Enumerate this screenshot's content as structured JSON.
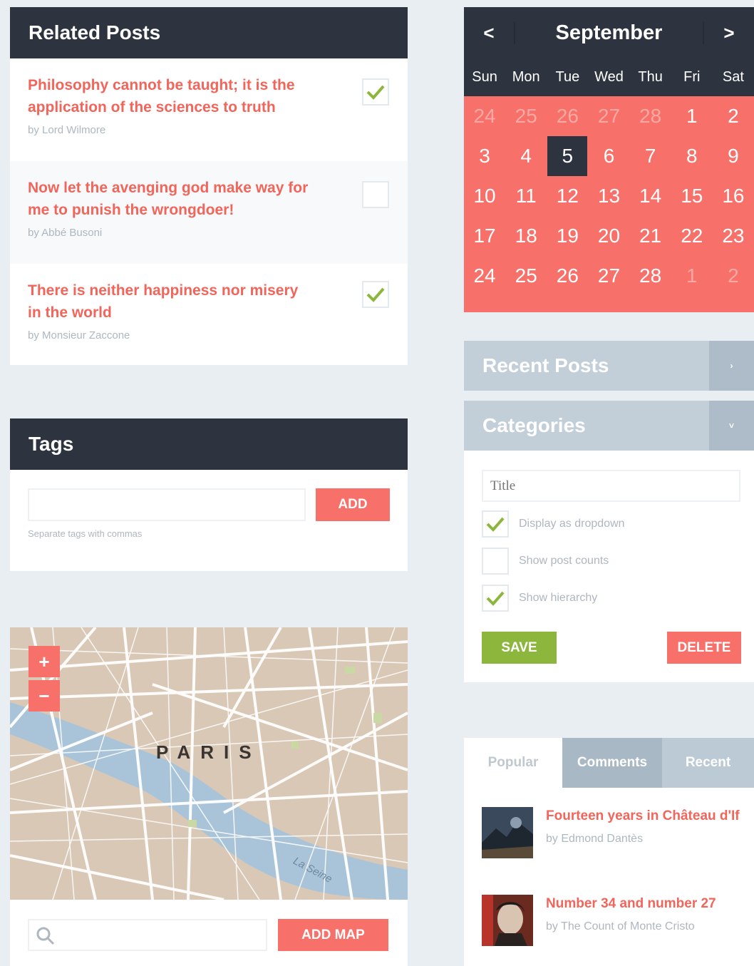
{
  "related_posts": {
    "title": "Related Posts",
    "items": [
      {
        "title": "Philosophy cannot be taught; it is the application of the sciences to truth",
        "author": "by Lord Wilmore",
        "checked": true
      },
      {
        "title": "Now let the avenging god make way for me to punish the wrongdoer!",
        "author": "by Abbé Busoni",
        "checked": false
      },
      {
        "title": "There is neither happiness nor misery in the world",
        "author": "by Monsieur Zaccone",
        "checked": true
      }
    ]
  },
  "tags": {
    "title": "Tags",
    "input_value": "",
    "add_label": "ADD",
    "hint": "Separate tags with commas"
  },
  "map": {
    "zoom_in": "+",
    "zoom_out": "−",
    "city_label": "PARIS",
    "river_label": "La Seine",
    "search_value": "",
    "add_label": "ADD MAP"
  },
  "calendar": {
    "month": "September",
    "prev": "<",
    "next": ">",
    "weekdays": [
      "Sun",
      "Mon",
      "Tue",
      "Wed",
      "Thu",
      "Fri",
      "Sat"
    ],
    "cells": [
      {
        "d": "24",
        "m": true
      },
      {
        "d": "25",
        "m": true
      },
      {
        "d": "26",
        "m": true
      },
      {
        "d": "27",
        "m": true
      },
      {
        "d": "28",
        "m": true
      },
      {
        "d": "1"
      },
      {
        "d": "2"
      },
      {
        "d": "3"
      },
      {
        "d": "4"
      },
      {
        "d": "5",
        "today": true
      },
      {
        "d": "6"
      },
      {
        "d": "7"
      },
      {
        "d": "8"
      },
      {
        "d": "9"
      },
      {
        "d": "10"
      },
      {
        "d": "11"
      },
      {
        "d": "12"
      },
      {
        "d": "13"
      },
      {
        "d": "14"
      },
      {
        "d": "15"
      },
      {
        "d": "16"
      },
      {
        "d": "17"
      },
      {
        "d": "18"
      },
      {
        "d": "19"
      },
      {
        "d": "20"
      },
      {
        "d": "21"
      },
      {
        "d": "22"
      },
      {
        "d": "23"
      },
      {
        "d": "24"
      },
      {
        "d": "25"
      },
      {
        "d": "26"
      },
      {
        "d": "27"
      },
      {
        "d": "28"
      },
      {
        "d": "1",
        "m": true
      },
      {
        "d": "2",
        "m": true
      }
    ]
  },
  "recent_posts": {
    "title": "Recent Posts",
    "toggle": "›"
  },
  "categories": {
    "title": "Categories",
    "toggle": "˅",
    "title_placeholder": "Title",
    "options": [
      {
        "label": "Display as dropdown",
        "checked": true
      },
      {
        "label": "Show post counts",
        "checked": false
      },
      {
        "label": "Show hierarchy",
        "checked": true
      }
    ],
    "save_label": "SAVE",
    "delete_label": "DELETE"
  },
  "tabs": {
    "labels": [
      "Popular",
      "Comments",
      "Recent"
    ],
    "items": [
      {
        "title": "Fourteen years in Château d'If",
        "author": "by Edmond Dantès"
      },
      {
        "title": "Number 34 and number 27",
        "author": "by The Count of Monte Cristo"
      }
    ]
  },
  "colors": {
    "accent_red": "#f7706a",
    "dark": "#2d3440",
    "green": "#8db63c",
    "gray_blue": "#c3cfd8"
  }
}
